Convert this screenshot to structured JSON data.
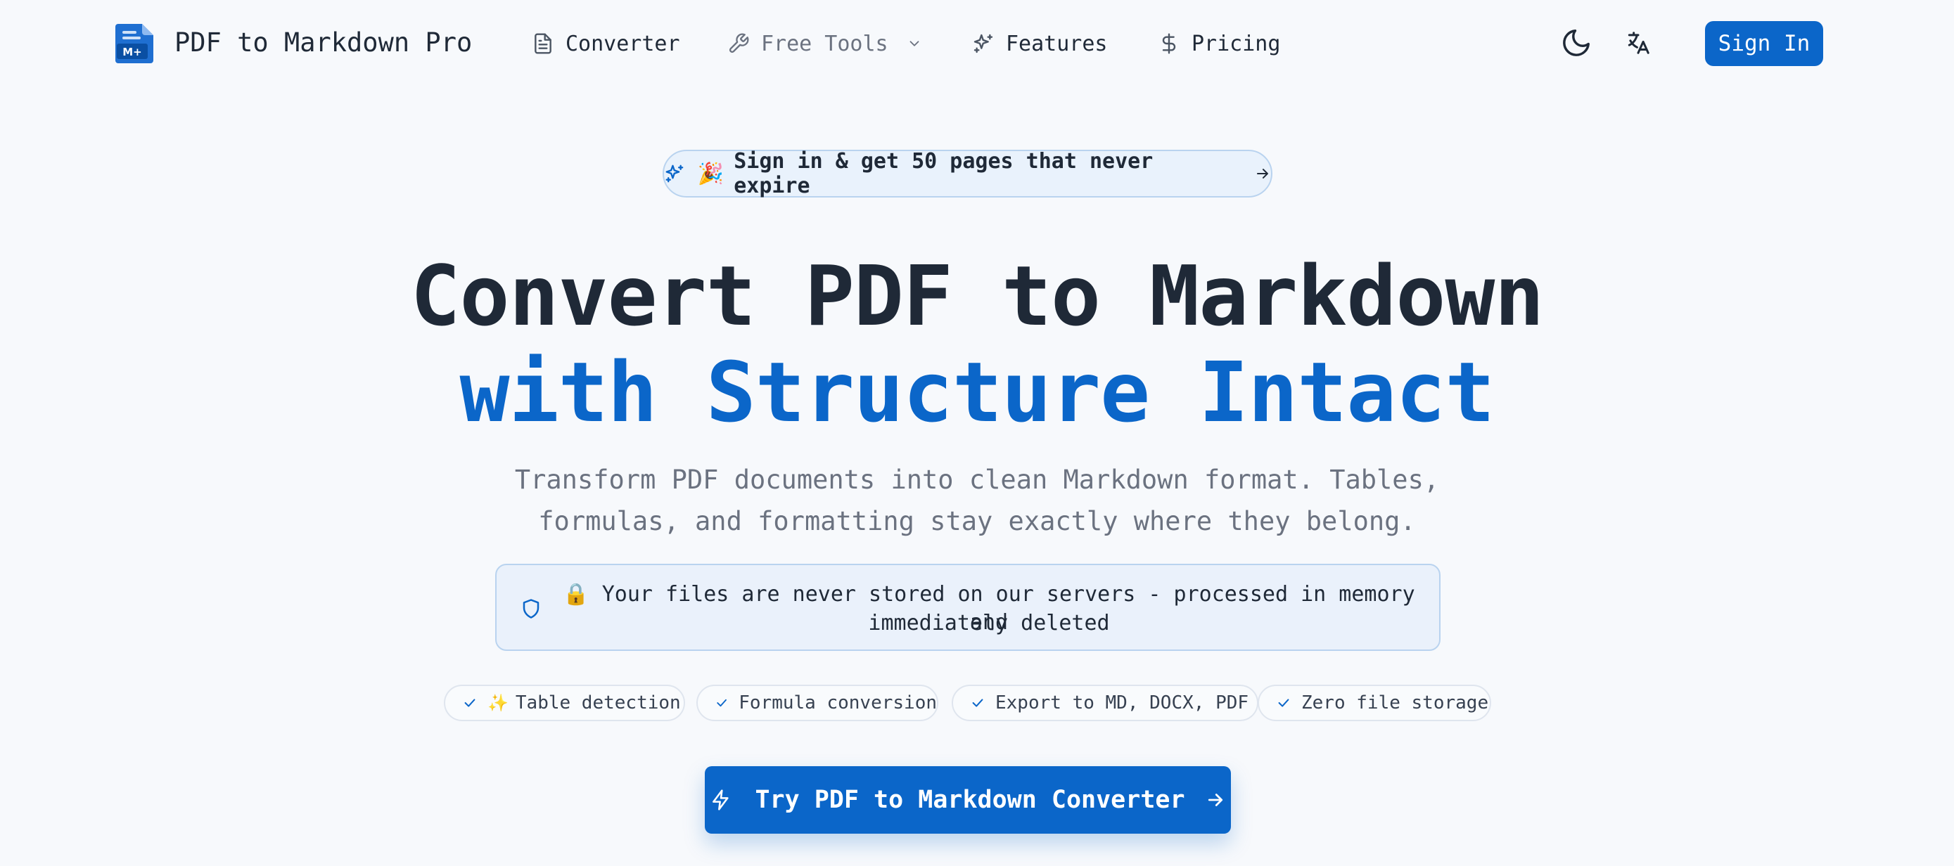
{
  "brand": {
    "name": "PDF to Markdown Pro",
    "logo_text": "M+"
  },
  "nav": {
    "items": [
      {
        "label": "Converter",
        "icon": "file-text-icon"
      },
      {
        "label": "Free Tools",
        "icon": "wrench-icon",
        "has_dropdown": true
      },
      {
        "label": "Features",
        "icon": "sparkles-icon"
      },
      {
        "label": "Pricing",
        "icon": "dollar-icon"
      }
    ],
    "theme_icon": "moon-icon",
    "language_icon": "translate-icon",
    "signin_label": "Sign In"
  },
  "promo": {
    "emoji": "🎉",
    "text": "Sign in & get 50 pages that never expire"
  },
  "hero": {
    "title_line1": "Convert PDF to Markdown",
    "title_line2": "with Structure Intact",
    "subtitle_line1": "Transform PDF documents into clean Markdown format. Tables,",
    "subtitle_line2": "formulas, and formatting stay exactly where they belong."
  },
  "privacy": {
    "lock_emoji": "🔒",
    "line1": "Your files are never stored on our servers - processed in memory and",
    "line2": "immediately deleted"
  },
  "features": [
    {
      "label": "Table detection",
      "sparkle": "✨"
    },
    {
      "label": "Formula conversion"
    },
    {
      "label": "Export to MD, DOCX, PDF"
    },
    {
      "label": "Zero file storage"
    }
  ],
  "cta": {
    "label": "Try PDF to Markdown Converter"
  },
  "colors": {
    "accent": "#0b66c9",
    "background": "#f7f9fc",
    "heading": "#1f2937",
    "muted": "#6b7280"
  }
}
